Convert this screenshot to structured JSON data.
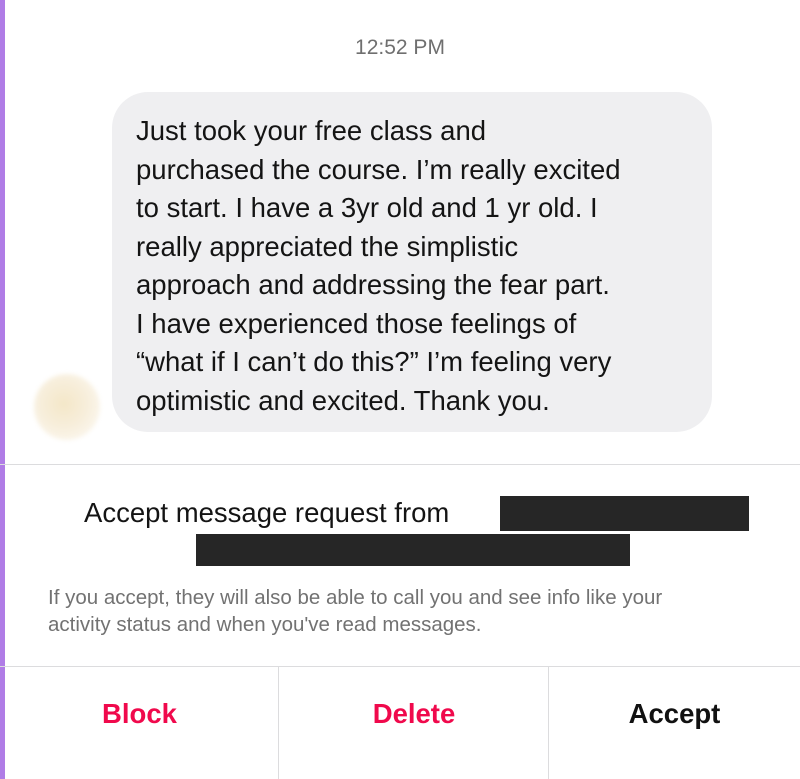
{
  "timestamp": "12:52 PM",
  "message": {
    "lines": [
      "Just took your free class and",
      "purchased the course. I’m really excited",
      "to start. I have a 3yr old and 1 yr old. I",
      "really appreciated the simplistic",
      "approach and addressing the fear part.",
      "I have experienced those feelings of",
      "“what if I can’t do this?” I’m feeling very",
      "optimistic and excited. Thank you."
    ]
  },
  "request": {
    "title": "Accept message request from",
    "info_lines": [
      "If you accept, they will also be able to call you and see info like your",
      "activity status and when you've read messages."
    ]
  },
  "actions": {
    "block": "Block",
    "delete": "Delete",
    "accept": "Accept"
  },
  "colors": {
    "destructive": "#f0094c",
    "bubble": "#efeff1",
    "accent_edge": "#b07ce6"
  }
}
